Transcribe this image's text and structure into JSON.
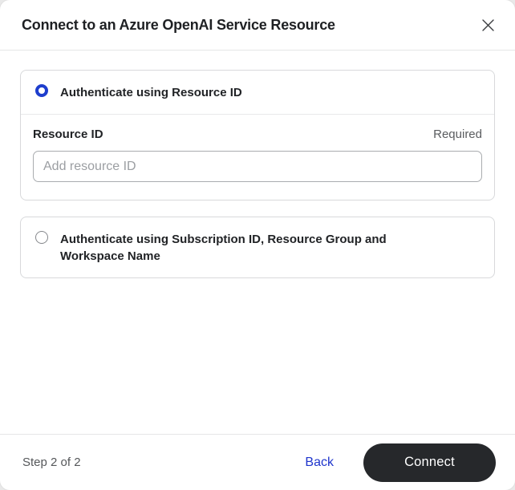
{
  "dialog": {
    "title": "Connect to an Azure OpenAI Service Resource"
  },
  "options": [
    {
      "label": "Authenticate using Resource ID",
      "selected": true,
      "form": {
        "field_label": "Resource ID",
        "required_label": "Required",
        "input_value": "",
        "input_placeholder": "Add resource ID"
      }
    },
    {
      "label": "Authenticate using Subscription ID, Resource Group and Workspace Name",
      "selected": false
    }
  ],
  "footer": {
    "step_label": "Step 2 of 2",
    "back_label": "Back",
    "connect_label": "Connect"
  },
  "colors": {
    "accent_blue": "#1f35cc",
    "radio_selected_blue": "#1e3ecd",
    "connect_button_dark": "#26282b",
    "backdrop_gray": "#e9e9e9"
  }
}
